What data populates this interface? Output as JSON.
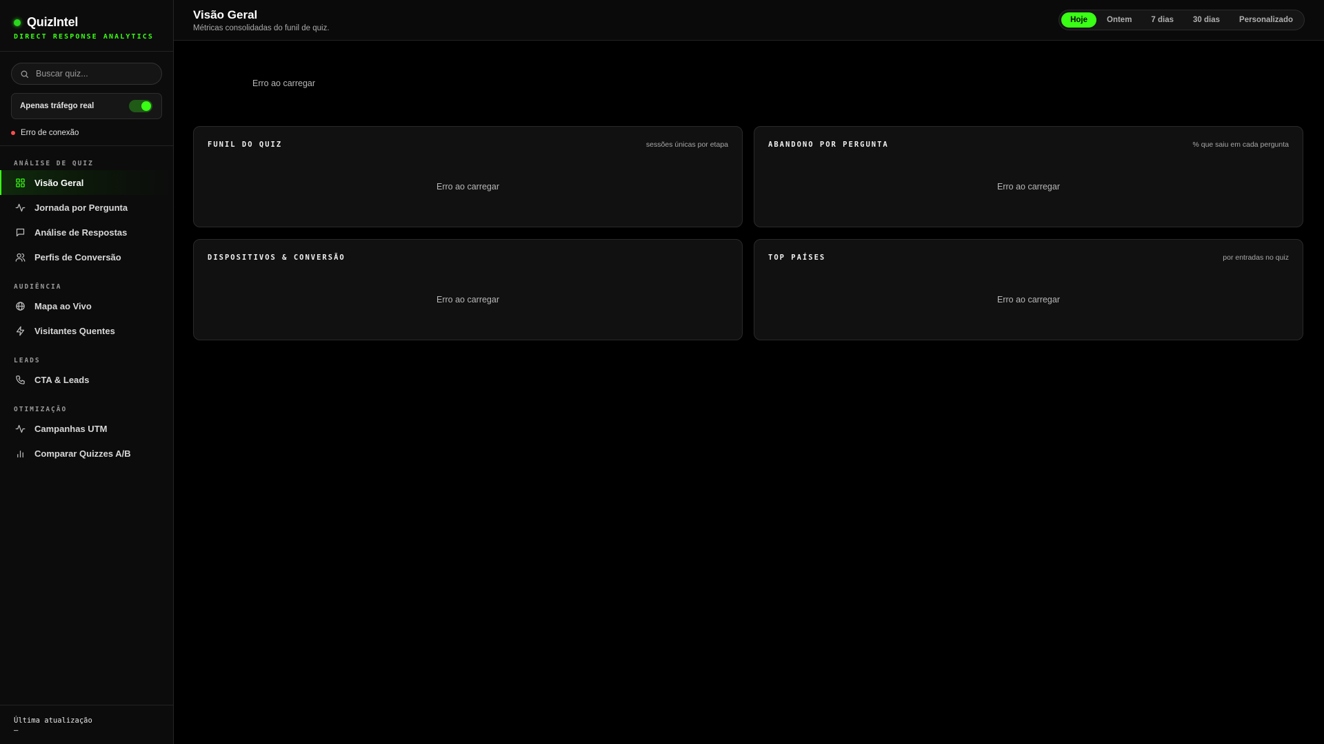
{
  "brand": {
    "name": "QuizIntel",
    "tagline": "DIRECT RESPONSE ANALYTICS",
    "accent": "#39ff14"
  },
  "search": {
    "placeholder": "Buscar quiz...",
    "value": ""
  },
  "real_traffic": {
    "label": "Apenas tráfego real",
    "enabled": true
  },
  "connection": {
    "status": "Erro de conexão",
    "color": "#ff4d4d"
  },
  "nav": {
    "sections": [
      {
        "title": "ANÁLISE DE QUIZ",
        "items": [
          {
            "label": "Visão Geral",
            "icon": "grid-icon",
            "active": true
          },
          {
            "label": "Jornada por Pergunta",
            "icon": "activity-icon"
          },
          {
            "label": "Análise de Respostas",
            "icon": "message-icon"
          },
          {
            "label": "Perfis de Conversão",
            "icon": "users-icon"
          }
        ]
      },
      {
        "title": "AUDIÊNCIA",
        "items": [
          {
            "label": "Mapa ao Vivo",
            "icon": "globe-icon"
          },
          {
            "label": "Visitantes Quentes",
            "icon": "zap-icon"
          }
        ]
      },
      {
        "title": "LEADS",
        "items": [
          {
            "label": "CTA & Leads",
            "icon": "phone-icon"
          }
        ]
      },
      {
        "title": "OTIMIZAÇÃO",
        "items": [
          {
            "label": "Campanhas UTM",
            "icon": "activity-icon"
          },
          {
            "label": "Comparar Quizzes A/B",
            "icon": "bar-chart-icon"
          }
        ]
      }
    ]
  },
  "footer": {
    "label": "Última atualização",
    "value": "—"
  },
  "header": {
    "title": "Visão Geral",
    "subtitle": "Métricas consolidadas do funil de quiz."
  },
  "date_range": {
    "options": [
      "Hoje",
      "Ontem",
      "7 dias",
      "30 dias",
      "Personalizado"
    ],
    "selected": "Hoje"
  },
  "kpi_status": "Erro ao carregar",
  "cards": [
    {
      "title": "FUNIL DO QUIZ",
      "meta": "sessões únicas por etapa",
      "status": "Erro ao carregar"
    },
    {
      "title": "ABANDONO POR PERGUNTA",
      "meta": "% que saiu em cada pergunta",
      "status": "Erro ao carregar"
    },
    {
      "title": "DISPOSITIVOS & CONVERSÃO",
      "meta": "",
      "status": "Erro ao carregar"
    },
    {
      "title": "TOP PAÍSES",
      "meta": "por entradas no quiz",
      "status": "Erro ao carregar"
    }
  ]
}
